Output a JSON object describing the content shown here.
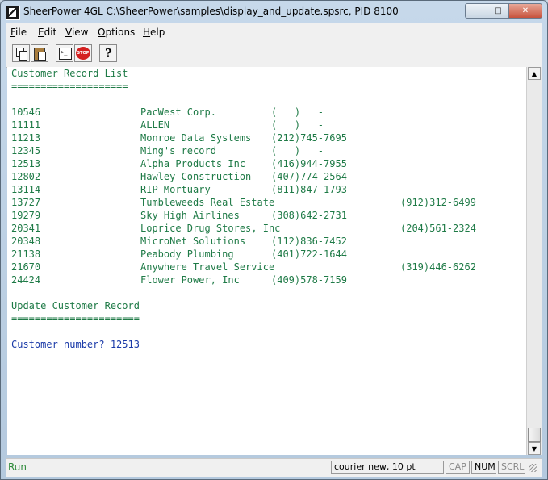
{
  "window": {
    "title": "SheerPower 4GL C:\\SheerPower\\samples\\display_and_update.spsrc, PID 8100",
    "minimize_icon": "minimize-icon",
    "maximize_icon": "maximize-icon",
    "close_icon": "close-icon"
  },
  "menu": [
    {
      "first": "F",
      "rest": "ile"
    },
    {
      "first": "E",
      "rest": "dit"
    },
    {
      "first": "V",
      "rest": "iew"
    },
    {
      "first": "O",
      "rest": "ptions"
    },
    {
      "first": "H",
      "rest": "elp"
    }
  ],
  "toolbar": {
    "icons": [
      "copy-icon",
      "paste-icon",
      "run-console-icon",
      "stop-icon",
      "help-icon"
    ]
  },
  "console": {
    "heading1": "Customer Record List",
    "rule1": "====================",
    "records": [
      {
        "id": "10546",
        "name": "PacWest Corp.",
        "phone": "(   )   -",
        "phone2": ""
      },
      {
        "id": "11111",
        "name": "ALLEN",
        "phone": "(   )   -",
        "phone2": ""
      },
      {
        "id": "11213",
        "name": "Monroe Data Systems",
        "phone": "(212)745-7695",
        "phone2": ""
      },
      {
        "id": "12345",
        "name": "Ming's record",
        "phone": "(   )   -",
        "phone2": ""
      },
      {
        "id": "12513",
        "name": "Alpha Products Inc",
        "phone": "(416)944-7955",
        "phone2": ""
      },
      {
        "id": "12802",
        "name": "Hawley Construction",
        "phone": "(407)774-2564",
        "phone2": ""
      },
      {
        "id": "13114",
        "name": "RIP Mortuary",
        "phone": "(811)847-1793",
        "phone2": ""
      },
      {
        "id": "13727",
        "name": "Tumbleweeds Real Estate",
        "phone": "",
        "phone2": "(912)312-6499"
      },
      {
        "id": "19279",
        "name": "Sky High Airlines",
        "phone": "(308)642-2731",
        "phone2": ""
      },
      {
        "id": "20341",
        "name": "Loprice Drug Stores, Inc",
        "phone": "",
        "phone2": "(204)561-2324"
      },
      {
        "id": "20348",
        "name": "MicroNet Solutions",
        "phone": "(112)836-7452",
        "phone2": ""
      },
      {
        "id": "21138",
        "name": "Peabody Plumbing",
        "phone": "(401)722-1644",
        "phone2": ""
      },
      {
        "id": "21670",
        "name": "Anywhere Travel Service",
        "phone": "",
        "phone2": "(319)446-6262"
      },
      {
        "id": "24424",
        "name": "Flower Power, Inc",
        "phone": "(409)578-7159",
        "phone2": ""
      }
    ],
    "heading2": "Update Customer Record",
    "rule2": "======================",
    "prompt": "Customer number? 12513",
    "cursor": "_"
  },
  "status": {
    "state": "Run",
    "font": "courier new, 10 pt",
    "cap": "CAP",
    "num": "NUM",
    "scrl": "SCRL"
  },
  "colors": {
    "console_green": "#1e7a46",
    "console_blue": "#1a3aa8",
    "status_run": "#2e8b3a"
  }
}
